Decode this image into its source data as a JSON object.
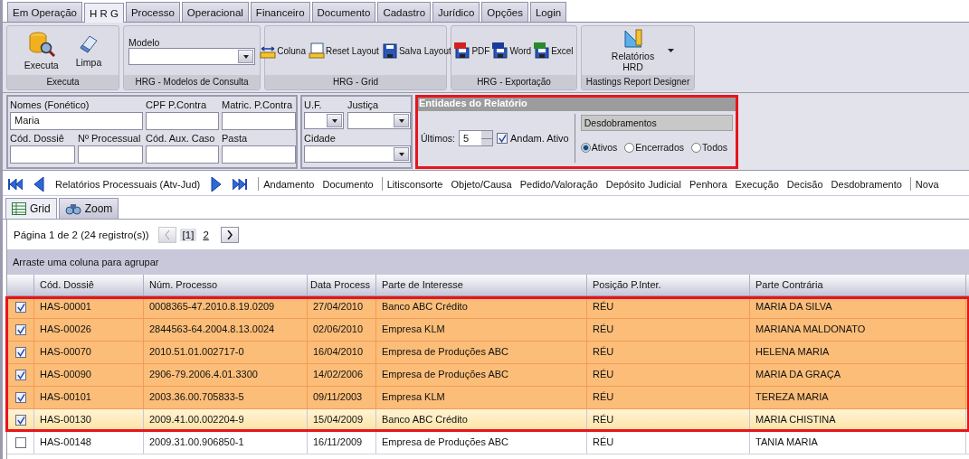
{
  "tabs": [
    {
      "label": "Em Operação",
      "selected": false
    },
    {
      "label": "H R G",
      "selected": true
    },
    {
      "label": "Processo",
      "selected": false
    },
    {
      "label": "Operacional",
      "selected": false
    },
    {
      "label": "Financeiro",
      "selected": false
    },
    {
      "label": "Documento",
      "selected": false
    },
    {
      "label": "Cadastro",
      "selected": false
    },
    {
      "label": "Jurídico",
      "selected": false
    },
    {
      "label": "Opções",
      "selected": false
    },
    {
      "label": "Login",
      "selected": false
    }
  ],
  "ribbon": {
    "groups": [
      {
        "title": "Executa",
        "items": [
          {
            "kind": "large",
            "label": "Executa"
          },
          {
            "kind": "large",
            "label": "Limpa"
          }
        ]
      },
      {
        "title": "HRG - Modelos de Consulta",
        "items": [
          {
            "kind": "combo",
            "label": "Modelo"
          }
        ]
      },
      {
        "title": "HRG - Grid",
        "items": [
          {
            "kind": "small",
            "label": "Coluna"
          },
          {
            "kind": "small",
            "label": "Reset Layout"
          },
          {
            "kind": "small",
            "label": "Salva Layout"
          }
        ]
      },
      {
        "title": "HRG - Exportação",
        "items": [
          {
            "kind": "small",
            "label": "PDF"
          },
          {
            "kind": "small",
            "label": "Word"
          },
          {
            "kind": "small",
            "label": "Excel"
          }
        ]
      },
      {
        "title": "Hastings Report Designer",
        "items": [
          {
            "kind": "dropdown",
            "label": "Relatórios HRD"
          }
        ]
      }
    ]
  },
  "filters": {
    "fields": [
      {
        "label": "Nomes (Fonético)",
        "value": "Maria"
      },
      {
        "label": "CPF P.Contra"
      },
      {
        "label": "Matric. P.Contra"
      },
      {
        "label": "Cód. Dossiê"
      },
      {
        "label": "Nº Processual"
      },
      {
        "label": "Cód. Aux. Caso"
      },
      {
        "label": "Pasta"
      }
    ],
    "combos": [
      {
        "label": "U.F."
      },
      {
        "label": "Justiça"
      },
      {
        "label": "Cidade"
      }
    ]
  },
  "entities": {
    "title": "Entidades do Relatório",
    "highlighted": true,
    "last_label": "Últimos:",
    "last_value": "5",
    "active": {
      "label": "Andam. Ativo",
      "checked": true
    },
    "split_title": "Desdobramentos",
    "split_options": [
      {
        "label": "Ativos",
        "selected": true
      },
      {
        "label": "Encerrados",
        "selected": false
      },
      {
        "label": "Todos",
        "selected": false
      }
    ]
  },
  "navigator": {
    "title": "Relatórios Processuais (Atv-Jud)",
    "groups": [
      [
        "Andamento",
        "Documento"
      ],
      [
        "Litisconsorte",
        "Objeto/Causa",
        "Pedido/Valoração",
        "Depósito Judicial",
        "Penhora",
        "Execução",
        "Decisão",
        "Desdobramento"
      ],
      [
        "Nova"
      ]
    ]
  },
  "view_tabs": [
    {
      "label": "Grid",
      "selected": true
    },
    {
      "label": "Zoom",
      "selected": false
    }
  ],
  "pager": {
    "summary": "Página 1 de 2 (24 registro(s))",
    "pages": [
      {
        "label": "[1]",
        "selected": true
      },
      {
        "label": "2",
        "selected": false
      }
    ]
  },
  "group_hint": "Arraste uma coluna para agrupar",
  "table": {
    "columns": [
      "Cód. Dossiê",
      "Núm. Processo",
      "Data Process",
      "Parte de Interesse",
      "Posição P.Inter.",
      "Parte Contrária"
    ],
    "row_groups": [
      {
        "framed": true,
        "rows": [
          {
            "checked": true,
            "selected": true,
            "focused": false,
            "cells": [
              "HAS-00001",
              "0008365-47.2010.8.19.0209",
              "27/04/2010",
              "Banco ABC Crédito",
              "RÉU",
              "MARIA DA SILVA"
            ]
          },
          {
            "checked": true,
            "selected": true,
            "focused": false,
            "cells": [
              "HAS-00026",
              "2844563-64.2004.8.13.0024",
              "02/06/2010",
              "Empresa KLM",
              "RÉU",
              "MARIANA MALDONATO"
            ]
          },
          {
            "checked": true,
            "selected": true,
            "focused": false,
            "cells": [
              "HAS-00070",
              "2010.51.01.002717-0",
              "16/04/2010",
              "Empresa de Produções ABC",
              "RÉU",
              "HELENA MARIA"
            ]
          },
          {
            "checked": true,
            "selected": true,
            "focused": false,
            "cells": [
              "HAS-00090",
              "2906-79.2006.4.01.3300",
              "14/02/2006",
              "Empresa de Produções ABC",
              "RÉU",
              "MARIA DA GRAÇA"
            ]
          },
          {
            "checked": true,
            "selected": true,
            "focused": false,
            "cells": [
              "HAS-00101",
              "2003.36.00.705833-5",
              "09/11/2003",
              "Empresa KLM",
              "RÉU",
              "TEREZA MARIA"
            ]
          },
          {
            "checked": true,
            "selected": false,
            "focused": true,
            "cells": [
              "HAS-00130",
              "2009.41.00.002204-9",
              "15/04/2009",
              "Banco ABC Crédito",
              "RÉU",
              "MARIA CHISTINA"
            ]
          }
        ]
      },
      {
        "framed": false,
        "rows": [
          {
            "checked": false,
            "selected": false,
            "focused": false,
            "cells": [
              "HAS-00148",
              "2009.31.00.906850-1",
              "16/11/2009",
              "Empresa de Produções ABC",
              "RÉU",
              "TANIA MARIA"
            ]
          }
        ]
      }
    ]
  }
}
